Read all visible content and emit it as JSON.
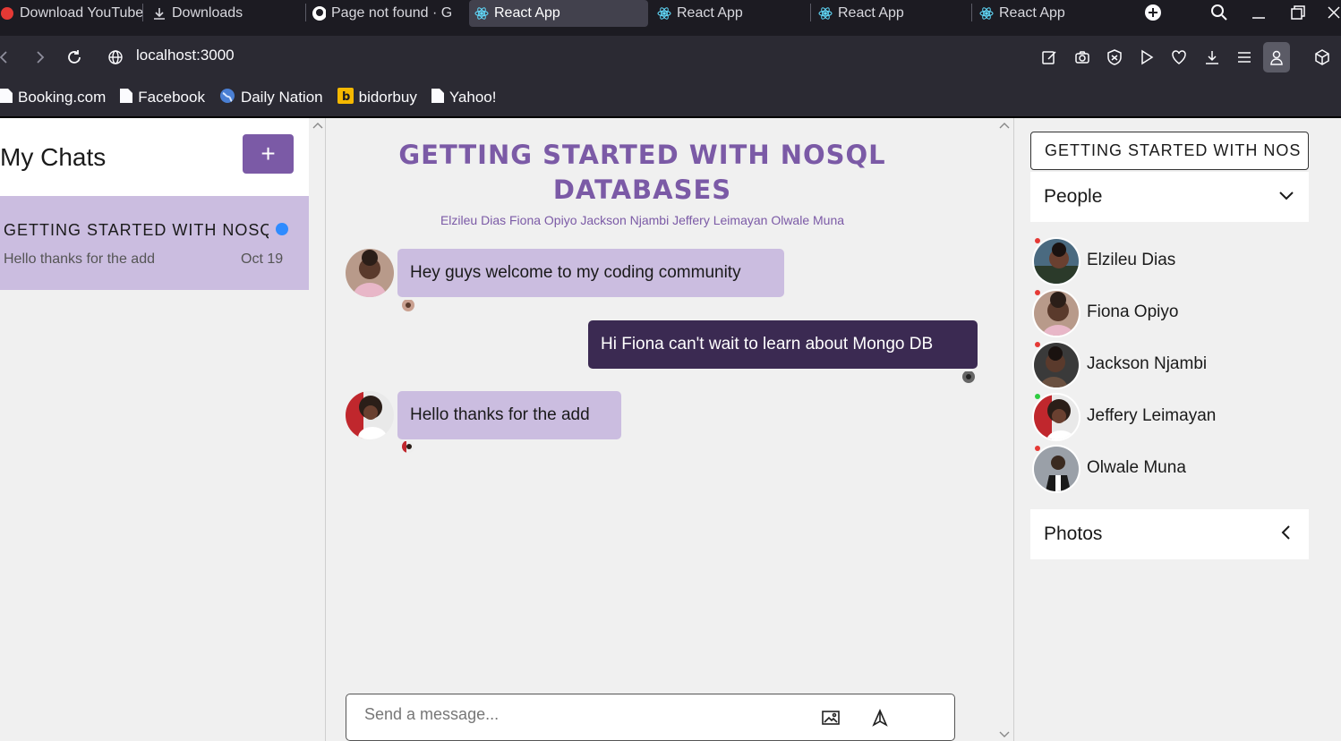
{
  "browser": {
    "tabs": [
      {
        "label": "Download YouTube",
        "icon": "youtube-icon"
      },
      {
        "label": "Downloads",
        "icon": "download-icon"
      },
      {
        "label": "Page not found · G",
        "icon": "github-icon"
      },
      {
        "label": "React App",
        "icon": "react-icon",
        "active": true
      },
      {
        "label": "React App",
        "icon": "react-icon"
      },
      {
        "label": "React App",
        "icon": "react-icon"
      },
      {
        "label": "React App",
        "icon": "react-icon"
      }
    ],
    "url": "localhost:3000",
    "bookmarks": [
      {
        "label": "Booking.com",
        "icon": "page-icon"
      },
      {
        "label": "Facebook",
        "icon": "page-icon"
      },
      {
        "label": "Daily Nation",
        "icon": "globe-icon"
      },
      {
        "label": "bidorbuy",
        "icon": "bidorbuy-icon"
      },
      {
        "label": "Yahoo!",
        "icon": "page-icon"
      }
    ]
  },
  "sidebar": {
    "title": "My Chats",
    "add_label": "+",
    "chats": [
      {
        "title": "GETTING STARTED WITH NOSQL",
        "preview": "Hello thanks for the add",
        "date": "Oct 19",
        "unread": true
      }
    ]
  },
  "conversation": {
    "title": "GETTING STARTED WITH NOSQL DATABASES",
    "members": "Elzileu Dias Fiona Opiyo Jackson Njambi Jeffery Leimayan Olwale Muna",
    "messages": [
      {
        "text": "Hey guys welcome to my coding community",
        "direction": "incoming",
        "sender": "Fiona Opiyo"
      },
      {
        "text": "Hi Fiona can't wait to learn about Mongo DB",
        "direction": "outgoing",
        "sender": "me"
      },
      {
        "text": "Hello thanks for the add",
        "direction": "incoming",
        "sender": "Jeffery Leimayan"
      }
    ],
    "composer": {
      "placeholder": "Send a message..."
    }
  },
  "details": {
    "title": "GETTING STARTED WITH NOS",
    "people_label": "People",
    "people": [
      {
        "name": "Elzileu Dias",
        "status": "offline"
      },
      {
        "name": "Fiona Opiyo",
        "status": "offline"
      },
      {
        "name": "Jackson Njambi",
        "status": "offline"
      },
      {
        "name": "Jeffery Leimayan",
        "status": "online"
      },
      {
        "name": "Olwale Muna",
        "status": "offline"
      }
    ],
    "photos_label": "Photos"
  },
  "colors": {
    "accent": "#7b5aa6",
    "bubble_in": "#cbbde0",
    "bubble_out": "#3b2a52",
    "online": "#2ecc40",
    "offline": "#e53935",
    "unread": "#2f8bff"
  }
}
